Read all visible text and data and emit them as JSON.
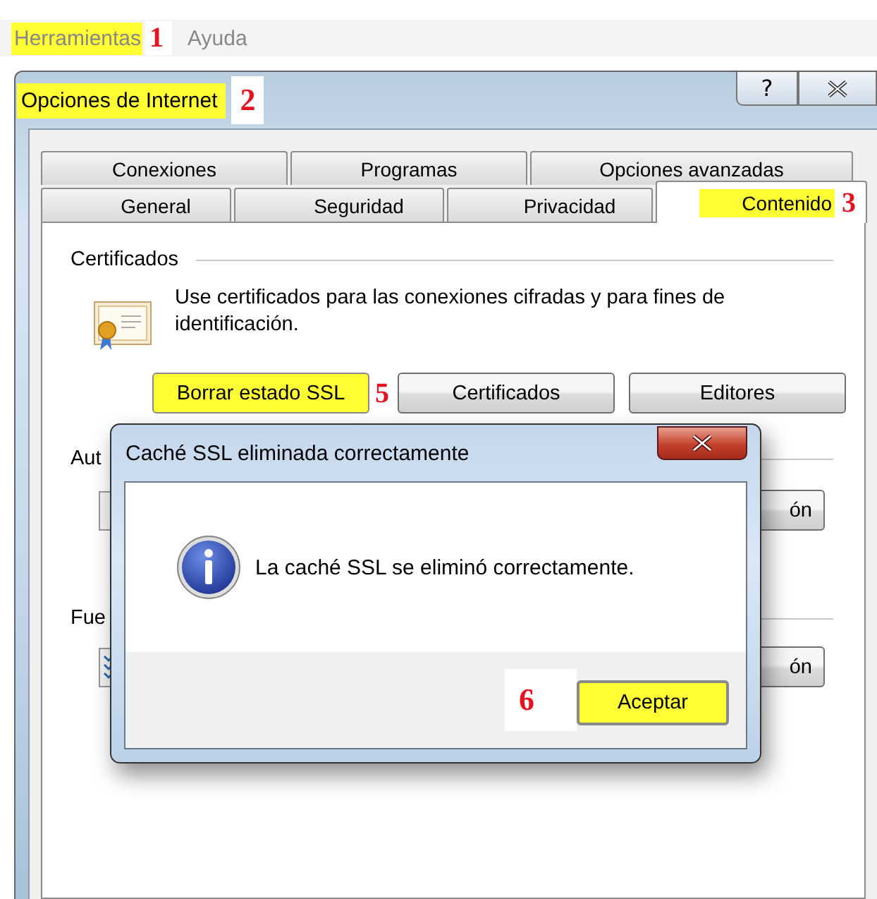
{
  "menu": [
    {
      "label": "Herramientas",
      "highlighted": true,
      "marker": "1"
    },
    {
      "label": "Ayuda",
      "highlighted": false
    }
  ],
  "window": {
    "title": "Opciones de Internet",
    "highlighted": true,
    "marker": "2",
    "help_button": "?"
  },
  "tabs_row_1": [
    {
      "label": "Conexiones",
      "selected": false
    },
    {
      "label": "Programas",
      "selected": false
    },
    {
      "label": "Opciones avanzadas",
      "selected": false
    }
  ],
  "tabs_row_2": [
    {
      "label": "General",
      "selected": false,
      "highlighted": false
    },
    {
      "label": "Seguridad",
      "selected": false,
      "highlighted": false
    },
    {
      "label": "Privacidad",
      "selected": false,
      "highlighted": false
    },
    {
      "label": "Contenido",
      "selected": true,
      "highlighted": true,
      "marker": "3"
    }
  ],
  "certificates": {
    "heading": "Certificados",
    "description": "Use certificados para las conexiones cifradas y para fines de identificación.",
    "buttons": [
      {
        "label": "Borrar estado SSL",
        "highlighted": true,
        "marker": "5"
      },
      {
        "label": "Certificados",
        "highlighted": false
      },
      {
        "label": "Editores",
        "highlighted": false
      }
    ]
  },
  "autocomplete": {
    "heading": "Aut",
    "button": "ón"
  },
  "feeds": {
    "heading": "Fue",
    "button": "ón"
  },
  "dialog": {
    "title": "Caché SSL eliminada correctamente",
    "message": "La caché SSL se eliminó correctamente.",
    "button": {
      "label": "Aceptar",
      "highlighted": true,
      "marker": "6"
    }
  }
}
